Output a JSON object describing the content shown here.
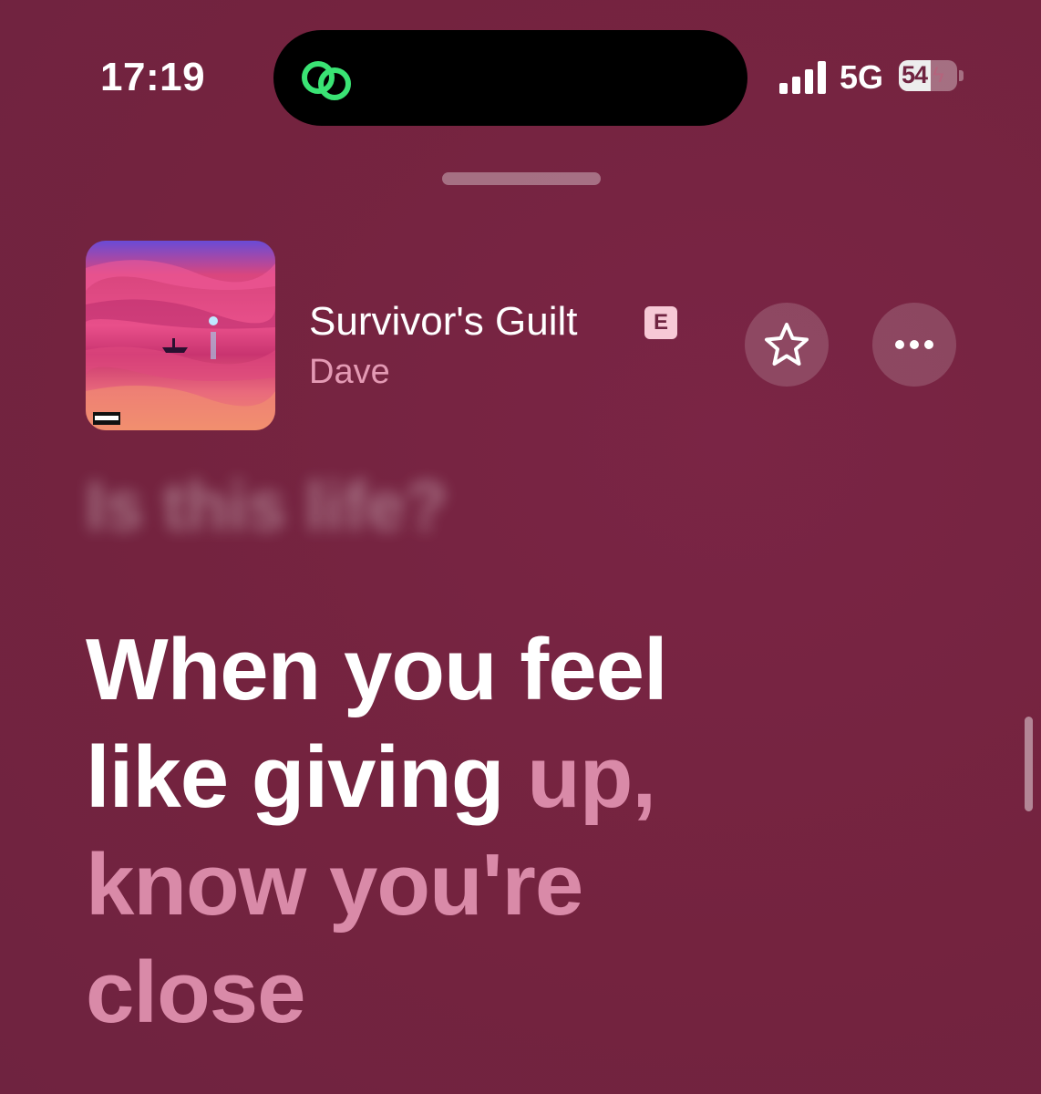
{
  "status_bar": {
    "time": "17:19",
    "network": "5G",
    "battery": "54",
    "battery_level": 0.54,
    "island_icon": "link-rings-icon"
  },
  "now_playing": {
    "title": "Survivor's Guilt",
    "explicit_badge": "E",
    "artist": "Dave",
    "favorite_icon": "star-outline-icon",
    "more_icon": "ellipsis-icon"
  },
  "lyrics": {
    "previous_line": "Is this life?",
    "current_line_1_sung": "When you feel",
    "current_line_2_sung": "like giving",
    "current_line_2_unsung": "up,",
    "next_line_1": "know you're",
    "next_line_2": "close"
  },
  "colors": {
    "background": "#74233f",
    "accent_pink": "#e49ab4",
    "unsung_lyric": "#d98aa8",
    "island_icon": "#3ae374"
  }
}
